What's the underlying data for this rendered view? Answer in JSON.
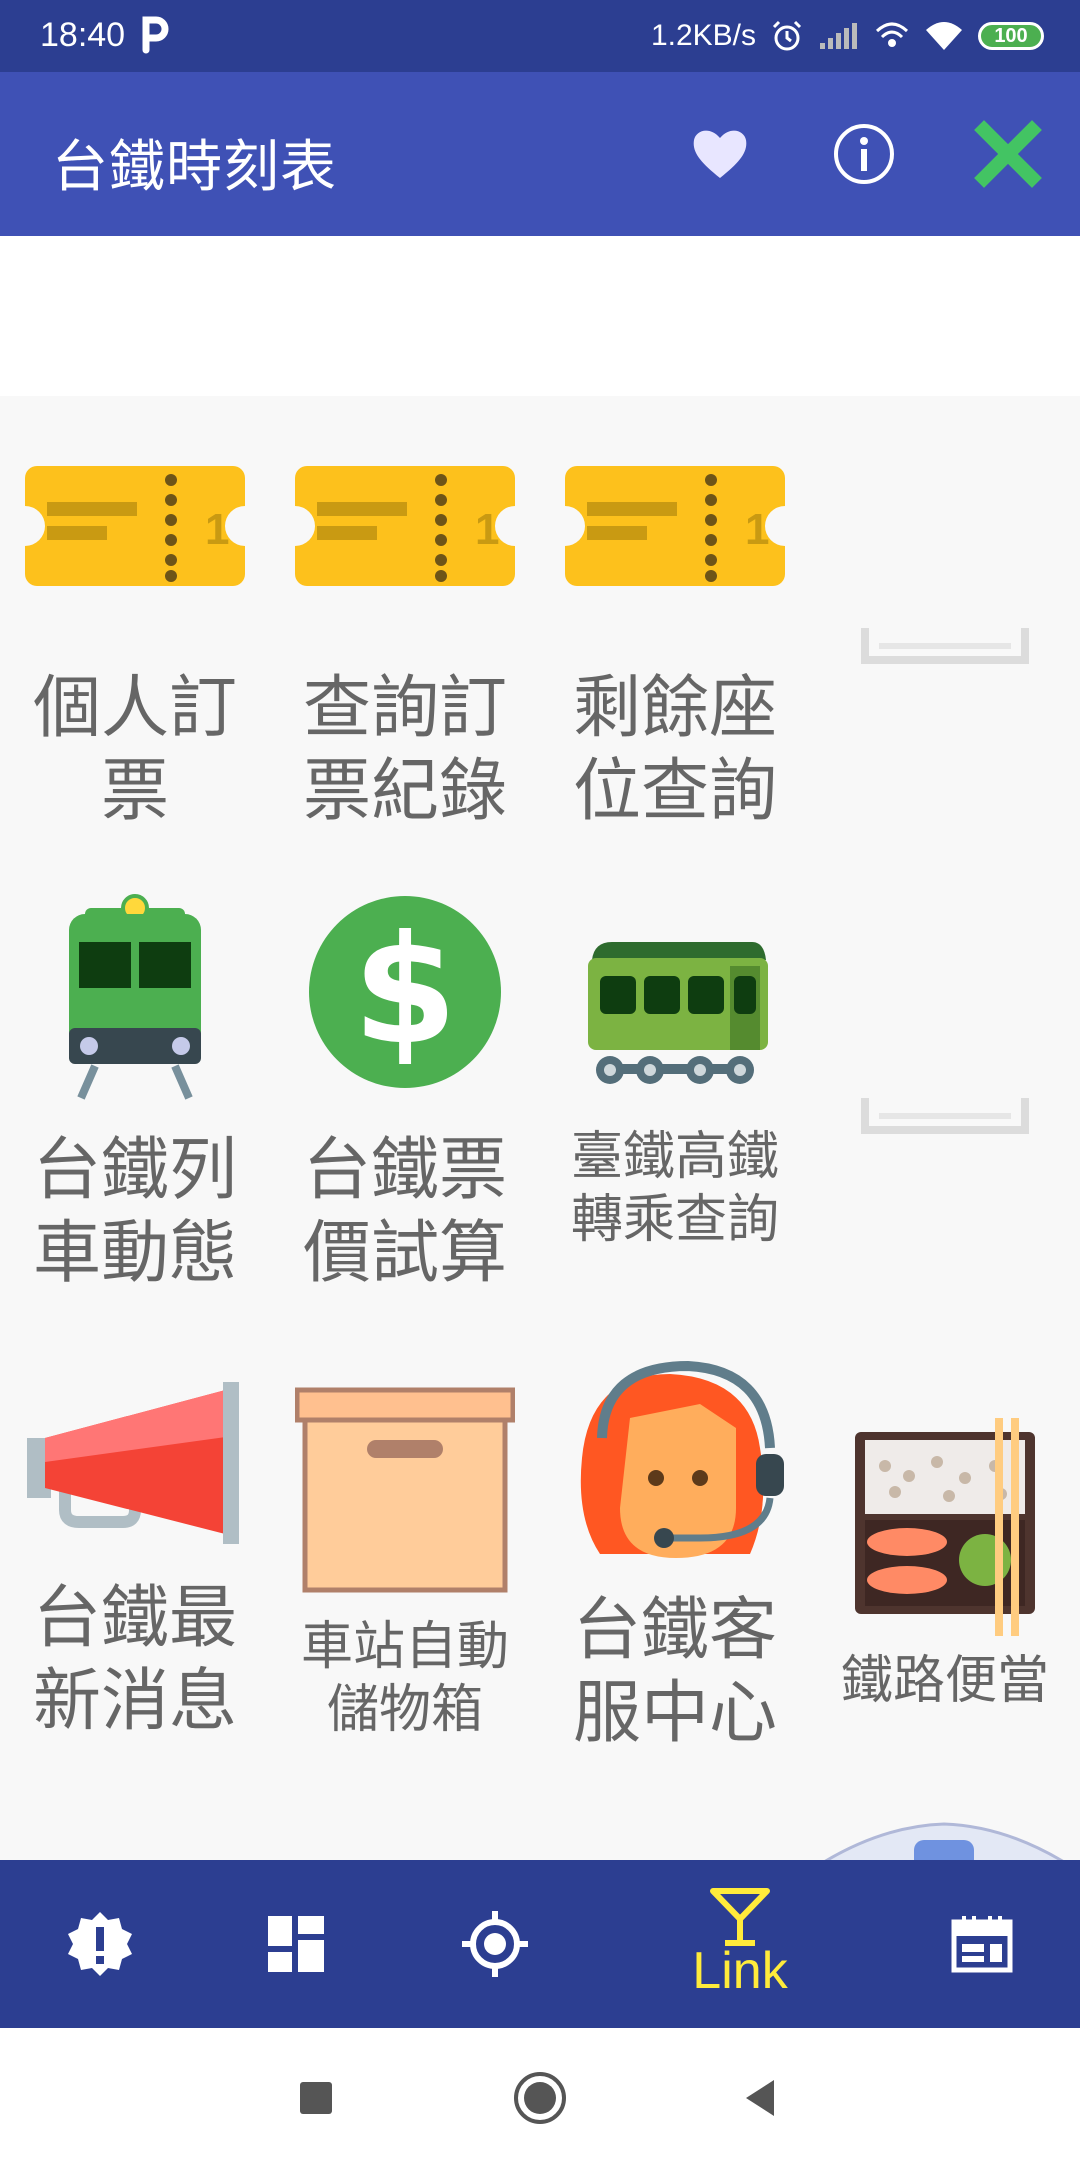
{
  "status_bar": {
    "time": "18:40",
    "network_speed": "1.2KB/s",
    "battery": "100",
    "icons": [
      "parking-app-icon",
      "alarm-icon",
      "signal-icon",
      "hotspot-icon",
      "wifi-icon",
      "battery-icon"
    ]
  },
  "app_bar": {
    "title": "台鐵時刻表",
    "actions": [
      "heart-icon",
      "info-icon",
      "close-icon"
    ],
    "colors": {
      "background": "#3f51b5",
      "heart": "#e8e6ff",
      "close": "#43c463"
    }
  },
  "grid": {
    "tiles": [
      {
        "label_line1": "個人訂",
        "label_line2": "票",
        "icon": "ticket-icon"
      },
      {
        "label_line1": "查詢訂",
        "label_line2": "票紀錄",
        "icon": "ticket-icon"
      },
      {
        "label_line1": "剩餘座",
        "label_line2": "位查詢",
        "icon": "ticket-icon"
      },
      {
        "label_line1": "",
        "label_line2": "",
        "icon": "placeholder-icon"
      },
      {
        "label_line1": "台鐵列",
        "label_line2": "車動態",
        "icon": "train-icon"
      },
      {
        "label_line1": "台鐵票",
        "label_line2": "價試算",
        "icon": "dollar-icon"
      },
      {
        "label_line1": "臺鐵高鐵",
        "label_line2": "轉乘查詢",
        "icon": "railcar-icon"
      },
      {
        "label_line1": "",
        "label_line2": "",
        "icon": "placeholder-icon"
      },
      {
        "label_line1": "台鐵最",
        "label_line2": "新消息",
        "icon": "megaphone-icon"
      },
      {
        "label_line1": "車站自動",
        "label_line2": "儲物箱",
        "icon": "box-icon"
      },
      {
        "label_line1": "台鐵客",
        "label_line2": "服中心",
        "icon": "customer-service-icon"
      },
      {
        "label_line1": "鐵路便當",
        "label_line2": "",
        "icon": "bento-icon"
      }
    ]
  },
  "bottom_nav": {
    "items": [
      {
        "icon": "alert-badge-icon",
        "label": ""
      },
      {
        "icon": "dashboard-icon",
        "label": ""
      },
      {
        "icon": "location-target-icon",
        "label": ""
      },
      {
        "icon": "cocktail-icon",
        "label": "Link",
        "selected": true
      },
      {
        "icon": "calendar-icon",
        "label": ""
      }
    ],
    "colors": {
      "background": "#2c3e91",
      "selected": "#ffeb3b"
    }
  },
  "system_nav": [
    "recents-button",
    "home-button",
    "back-button"
  ]
}
